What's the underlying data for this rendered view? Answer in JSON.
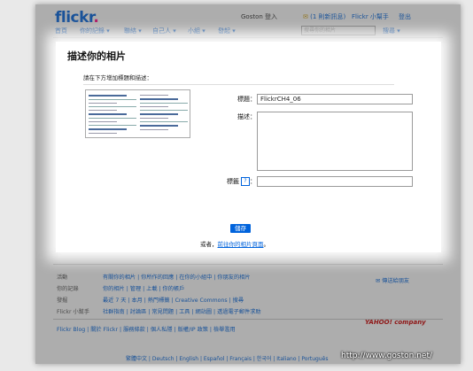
{
  "header": {
    "logo_main": "flickr",
    "logo_dot": ".",
    "user": "Goston 登入",
    "messages": "(1 則新訊息)",
    "help": "Flickr 小幫手",
    "logout": "登出",
    "nav": [
      "首頁",
      "你的記錄 ▾",
      "聯絡 ▾",
      "自己人 ▾",
      "小組 ▾",
      "發起 ▾"
    ],
    "search_placeholder": "搜尋你的相片",
    "search_button": "搜尋 ▾"
  },
  "page": {
    "title": "描述你的相片",
    "instruction": "請在下方增加標題和描述：",
    "title_label": "標題：",
    "title_value": "FlickrCH4_06",
    "description_label": "描述：",
    "tags_label": "標籤",
    "tags_suffix": "：",
    "help_glyph": "?",
    "save_button": "儲存",
    "or_text": "或者，",
    "back_link": "前往你的相片頁面",
    "or_suffix": "。"
  },
  "footer": {
    "rows": [
      {
        "label": "活動",
        "links": "有關你的相片 | 你所作的回應 | 在你的小組中 | 你朋友的相片"
      },
      {
        "label": "你的記錄",
        "links": "你的相片 | 管理 | 上載 | 你的帳戶"
      },
      {
        "label": "發掘",
        "links": "最近 7 天 | 本月 | 熱門標籤 | Creative Commons | 搜尋"
      },
      {
        "label": "Flickr 小幫手",
        "links": "社群指南 | 討論區 | 常見問題 | 工具 | 網站圖 | 透過電子郵件求助"
      }
    ],
    "side_link": "傳送給朋友",
    "bottom_links": "Flickr Blog | 關於 Flickr | 服務條款 | 個人私隱 | 版權/IP 政策 | 檢舉濫用",
    "yahoo": "YAHOO! company",
    "languages": "繁體中文 | Deutsch | English | Español | Français | 한국어 | Italiano | Português"
  },
  "watermark": "http://www.goston.net/"
}
